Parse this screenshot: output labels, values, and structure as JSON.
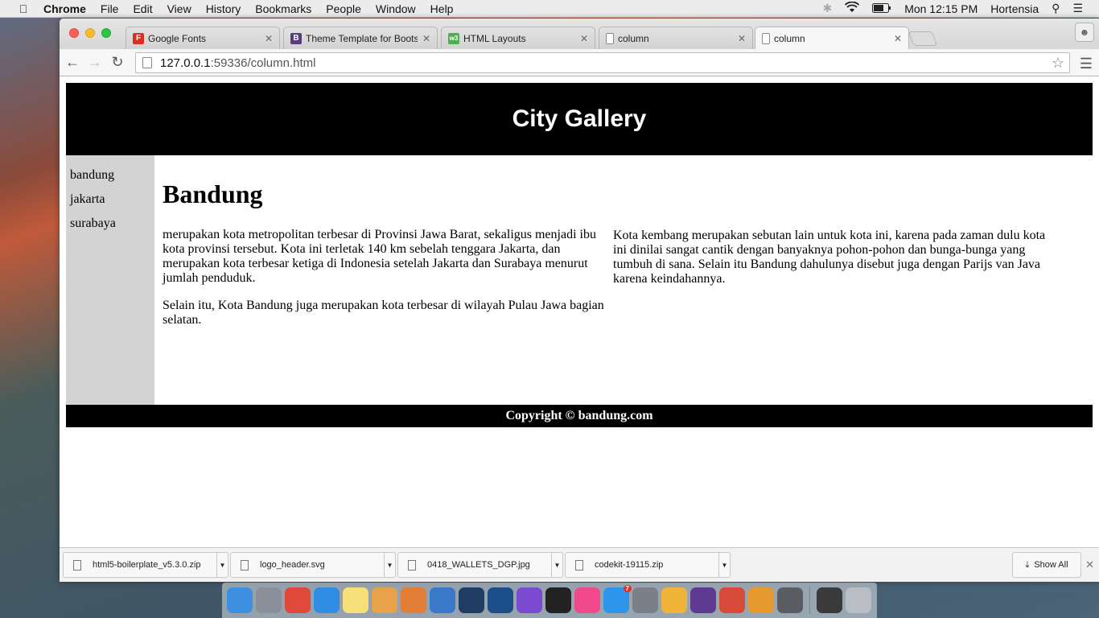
{
  "menubar": {
    "app": "Chrome",
    "items": [
      "File",
      "Edit",
      "View",
      "History",
      "Bookmarks",
      "People",
      "Window",
      "Help"
    ],
    "clock": "Mon 12:15 PM",
    "user": "Hortensia"
  },
  "tabs": [
    {
      "label": "Google Fonts",
      "icon": "google-fonts-icon",
      "color": "#d93025",
      "glyph": "F"
    },
    {
      "label": "Theme Template for Bootstrap",
      "icon": "bootstrap-icon",
      "color": "#563d7c",
      "glyph": "B"
    },
    {
      "label": "HTML Layouts",
      "icon": "w3schools-icon",
      "color": "#4caf50",
      "glyph": "w3"
    },
    {
      "label": "column",
      "icon": "page-icon",
      "color": "#ffffff",
      "glyph": ""
    },
    {
      "label": "column",
      "icon": "page-icon",
      "color": "#ffffff",
      "glyph": ""
    }
  ],
  "address": {
    "host": "127.0.0.1",
    "path": ":59336/column.html"
  },
  "site": {
    "header": "City Gallery",
    "nav": [
      "bandung",
      "jakarta",
      "surabaya"
    ],
    "heading": "Bandung",
    "col1_p1": "merupakan kota metropolitan terbesar di Provinsi Jawa Barat, sekaligus menjadi ibu kota provinsi tersebut. Kota ini terletak 140 km sebelah tenggara Jakarta, dan merupakan kota terbesar ketiga di Indonesia setelah Jakarta dan Surabaya menurut jumlah penduduk.",
    "col1_p2": "Selain itu, Kota Bandung juga merupakan kota terbesar di wilayah Pulau Jawa bagian selatan.",
    "col2_p1": "Kota kembang merupakan sebutan lain untuk kota ini, karena pada zaman dulu kota ini dinilai sangat cantik dengan banyaknya pohon-pohon dan bunga-bunga yang tumbuh di sana. Selain itu Bandung dahulunya disebut juga dengan Parijs van Java karena keindahannya.",
    "footer": "Copyright © bandung.com"
  },
  "downloads": [
    {
      "name": "html5-boilerplate_v5.3.0.zip"
    },
    {
      "name": "logo_header.svg"
    },
    {
      "name": "0418_WALLETS_DGP.jpg"
    },
    {
      "name": "codekit-19115.zip"
    }
  ],
  "show_all": "Show All",
  "dock": [
    {
      "name": "finder-icon",
      "color": "#3d8fe0"
    },
    {
      "name": "launchpad-icon",
      "color": "#8a8f99"
    },
    {
      "name": "chrome-icon",
      "color": "#e0483a"
    },
    {
      "name": "safari-icon",
      "color": "#2f8de4"
    },
    {
      "name": "notes-icon",
      "color": "#f7e07a"
    },
    {
      "name": "textedit-icon",
      "color": "#e8a24a"
    },
    {
      "name": "keynote-chart-icon",
      "color": "#e27d36"
    },
    {
      "name": "keynote-icon",
      "color": "#3a79c7"
    },
    {
      "name": "framer-icon",
      "color": "#1f3d63"
    },
    {
      "name": "sourcetree-icon",
      "color": "#1c4f8a"
    },
    {
      "name": "dash-icon",
      "color": "#7c4ad0"
    },
    {
      "name": "terminal-icon",
      "color": "#222222"
    },
    {
      "name": "itunes-icon",
      "color": "#f04a8c"
    },
    {
      "name": "app-store-icon",
      "color": "#2d95ea"
    },
    {
      "name": "system-preferences-icon",
      "color": "#7b7f88"
    },
    {
      "name": "photos-icon",
      "color": "#f0b43b"
    },
    {
      "name": "github-icon",
      "color": "#5e3a91"
    },
    {
      "name": "chrome-canary-icon",
      "color": "#d84a3a"
    },
    {
      "name": "preview-icon",
      "color": "#e69a2e"
    },
    {
      "name": "sublime-icon",
      "color": "#5a5e63"
    },
    {
      "name": "watch-icon",
      "color": "#3a3a3a"
    },
    {
      "name": "trash-icon",
      "color": "#b9bec4"
    }
  ],
  "app_store_badge": "7"
}
